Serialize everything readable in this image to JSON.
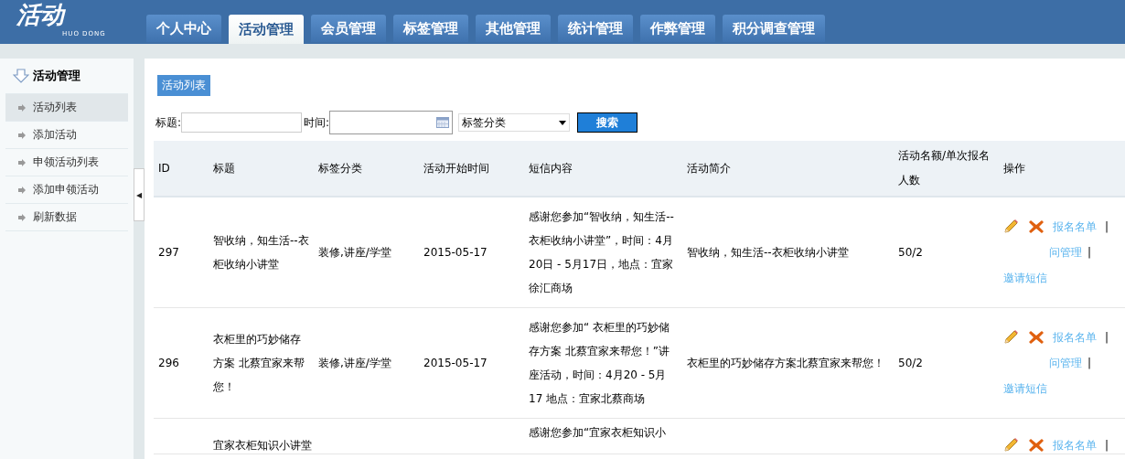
{
  "logo": {
    "title": "活动",
    "subtitle": "HUO DONG"
  },
  "tabs": [
    {
      "label": "个人中心",
      "selected": false
    },
    {
      "label": "活动管理",
      "selected": true
    },
    {
      "label": "会员管理",
      "selected": false
    },
    {
      "label": "标签管理",
      "selected": false
    },
    {
      "label": "其他管理",
      "selected": false
    },
    {
      "label": "统计管理",
      "selected": false
    },
    {
      "label": "作弊管理",
      "selected": false
    },
    {
      "label": "积分调查管理",
      "selected": false
    }
  ],
  "sidebar": {
    "heading": "活动管理",
    "items": [
      {
        "label": "活动列表",
        "selected": true
      },
      {
        "label": "添加活动",
        "selected": false
      },
      {
        "label": "申领活动列表",
        "selected": false
      },
      {
        "label": "添加申领活动",
        "selected": false
      },
      {
        "label": "刷新数据",
        "selected": false
      }
    ]
  },
  "collapse_handle": "◀",
  "section_title": "活动列表",
  "filters": {
    "title_label": "标题:",
    "time_label": "时间:",
    "category": "标签分类",
    "search_button": "搜索"
  },
  "table": {
    "columns": [
      "ID",
      "标题",
      "标签分类",
      "活动开始时间",
      "短信内容",
      "活动简介",
      "活动名额/单次报名人数",
      "操作"
    ],
    "rows": [
      {
        "id": "297",
        "title": "智收纳，知生活--衣柜收纳小讲堂",
        "category": "装修,讲座/学堂",
        "start": "2015-05-17",
        "sms": "感谢您参加“智收纳，知生活--衣柜收纳小讲堂”，时间：4月20日  - 5月17日，地点：宜家徐汇商场",
        "intro": "智收纳，知生活--衣柜收纳小讲堂",
        "quota": "50/2",
        "actions": [
          "报名名单",
          "问管理",
          "邀请短信"
        ],
        "separators": [
          "|",
          "|"
        ]
      },
      {
        "id": "296",
        "title": "衣柜里的巧妙储存方案  北蔡宜家来帮您！",
        "category": "装修,讲座/学堂",
        "start": "2015-05-17",
        "sms": "感谢您参加“  衣柜里的巧妙储存方案  北蔡宜家来帮您！”讲座活动，时间：4月20 - 5月17 地点：宜家北蔡商场",
        "intro": "衣柜里的巧妙储存方案北蔡宜家来帮您！",
        "quota": "50/2",
        "actions": [
          "报名名单",
          "问管理",
          "邀请短信"
        ],
        "separators": [
          "|",
          "|"
        ]
      },
      {
        "title": "宜家衣柜知识小讲堂",
        "sms": "感谢您参加“宜家衣柜知识小",
        "actions": [
          "报名名单"
        ],
        "separators": [
          "|"
        ]
      }
    ]
  }
}
